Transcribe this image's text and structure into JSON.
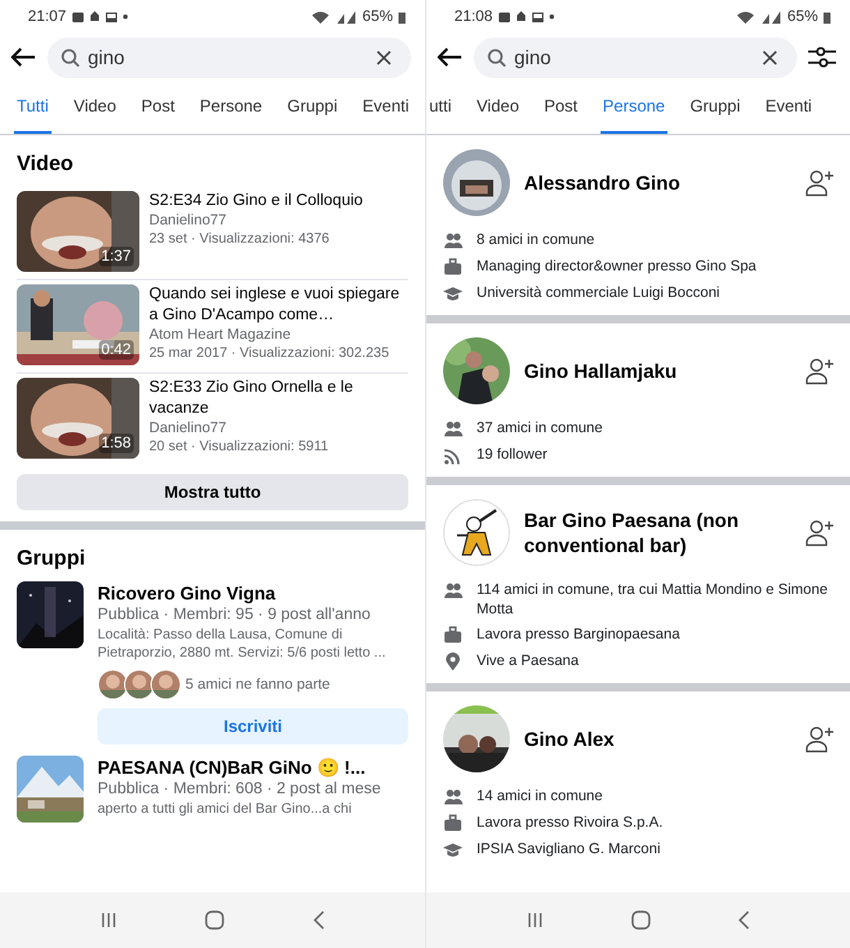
{
  "screens": [
    {
      "kind": "all",
      "status_bar": {
        "time": "21:07",
        "battery": "65%"
      },
      "search": {
        "value": "gino"
      },
      "filter_button": false,
      "tabs": [
        {
          "label": "Tutti",
          "selected": true
        },
        {
          "label": "Video",
          "selected": false
        },
        {
          "label": "Post",
          "selected": false
        },
        {
          "label": "Persone",
          "selected": false
        },
        {
          "label": "Gruppi",
          "selected": false
        },
        {
          "label": "Eventi",
          "selected": false
        }
      ],
      "videos": {
        "title": "Video",
        "items": [
          {
            "title": "S2:E34 Zio Gino e il Colloquio",
            "channel": "Danielino77",
            "meta": "23 set · Visualizzazioni: 4376",
            "duration": "1:37"
          },
          {
            "title": "Quando sei inglese e vuoi spiegare a Gino D'Acampo come…",
            "channel": "Atom Heart Magazine",
            "meta": "25 mar 2017 · Visualizzazioni: 302.235",
            "duration": "0:42"
          },
          {
            "title": "S2:E33 Zio Gino Ornella e le vacanze",
            "channel": "Danielino77",
            "meta": "20 set · Visualizzazioni: 5911",
            "duration": "1:58"
          }
        ],
        "button": "Mostra tutto"
      },
      "groups": {
        "title": "Gruppi",
        "items": [
          {
            "name": "Ricovero Gino Vigna",
            "meta": "Pubblica · Membri: 95 · 9 post all'anno",
            "description": "Località: Passo della Lausa, Comune di Pietraporzio, 2880 mt. Servizi: 5/6 posti letto ...",
            "friends": "5 amici ne fanno parte",
            "button": "Iscriviti"
          },
          {
            "name": "PAESANA (CN)BaR GiNo 🙂 !...",
            "meta": "Pubblica · Membri: 608 · 2 post al mese",
            "description": "aperto a tutti gli amici del Bar Gino...a chi"
          }
        ]
      }
    },
    {
      "kind": "people",
      "status_bar": {
        "time": "21:08",
        "battery": "65%"
      },
      "search": {
        "value": "gino"
      },
      "filter_button": true,
      "tabs": [
        {
          "label": "utti",
          "selected": false
        },
        {
          "label": "Video",
          "selected": false
        },
        {
          "label": "Post",
          "selected": false
        },
        {
          "label": "Persone",
          "selected": true
        },
        {
          "label": "Gruppi",
          "selected": false
        },
        {
          "label": "Eventi",
          "selected": false
        }
      ],
      "people": [
        {
          "name": "Alessandro Gino",
          "details": [
            {
              "kind": "friends",
              "text": "8 amici in comune"
            },
            {
              "kind": "work",
              "text": "Managing director&owner presso Gino Spa"
            },
            {
              "kind": "school",
              "text": "Università commerciale Luigi Bocconi"
            }
          ]
        },
        {
          "name": "Gino Hallamjaku",
          "details": [
            {
              "kind": "friends",
              "text": "37 amici in comune"
            },
            {
              "kind": "follower",
              "text": "19 follower"
            }
          ]
        },
        {
          "name": "Bar Gino Paesana (non conventional bar)",
          "details": [
            {
              "kind": "friends",
              "text": "114 amici in comune, tra cui Mattia Mondino e Simone Motta"
            },
            {
              "kind": "work",
              "text": "Lavora presso Barginopaesana"
            },
            {
              "kind": "location",
              "text": "Vive a Paesana"
            }
          ]
        },
        {
          "name": "Gino Alex",
          "details": [
            {
              "kind": "friends",
              "text": "14 amici in comune"
            },
            {
              "kind": "work",
              "text": "Lavora presso Rivoira S.p.A."
            },
            {
              "kind": "school",
              "text": "IPSIA Savigliano G. Marconi"
            }
          ]
        }
      ]
    }
  ]
}
